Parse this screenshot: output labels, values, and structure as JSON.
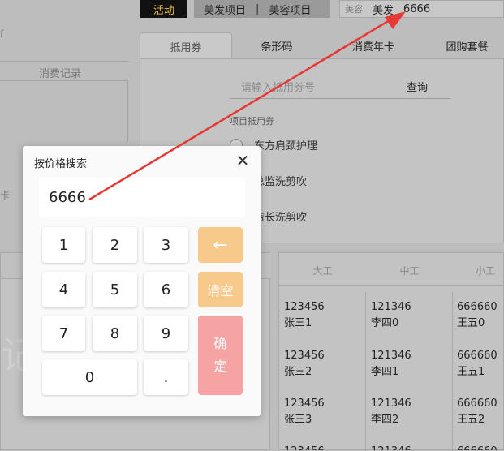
{
  "topbar": {
    "activity_label": "活动",
    "segment_left": "美发项目",
    "segment_sep": "|",
    "segment_right": "美容项目",
    "search_prefix": "美容",
    "search_category": "美发",
    "search_value": "6666"
  },
  "left_panel": {
    "header": "消费记录",
    "edge_char_top": "f",
    "edge_char_mid": "卡",
    "faded_text": "记"
  },
  "tabs": [
    {
      "label": "抵用券"
    },
    {
      "label": "条形码"
    },
    {
      "label": "消费年卡"
    },
    {
      "label": "团购套餐"
    }
  ],
  "voucher": {
    "placeholder": "请输入抵用券号",
    "query_label": "查询",
    "section_title": "项目抵用券",
    "items": [
      "东方肩颈护理",
      "总监洗剪吹",
      "店长洗剪吹"
    ]
  },
  "staff_table": {
    "columns": [
      "大工",
      "中工",
      "小工"
    ],
    "rows": [
      [
        {
          "code": "123456",
          "name": "张三1"
        },
        {
          "code": "121346",
          "name": "李四0"
        },
        {
          "code": "666660",
          "name": "王五0"
        }
      ],
      [
        {
          "code": "123456",
          "name": "张三2"
        },
        {
          "code": "121346",
          "name": "李四1"
        },
        {
          "code": "666660",
          "name": "王五1"
        }
      ],
      [
        {
          "code": "123456",
          "name": "张三3"
        },
        {
          "code": "121346",
          "name": "李四2"
        },
        {
          "code": "666660",
          "name": "王五2"
        }
      ],
      [
        {
          "code": "123456",
          "name": ""
        },
        {
          "code": "121346",
          "name": ""
        },
        {
          "code": "666660",
          "name": ""
        }
      ]
    ]
  },
  "modal": {
    "title": "按价格搜索",
    "display_value": "6666",
    "keys": [
      "1",
      "2",
      "3",
      "4",
      "5",
      "6",
      "7",
      "8",
      "9",
      "0",
      "."
    ],
    "backspace_glyph": "←",
    "clear_label": "清空",
    "confirm_line1": "确",
    "confirm_line2": "定",
    "close_glyph": "✕"
  }
}
